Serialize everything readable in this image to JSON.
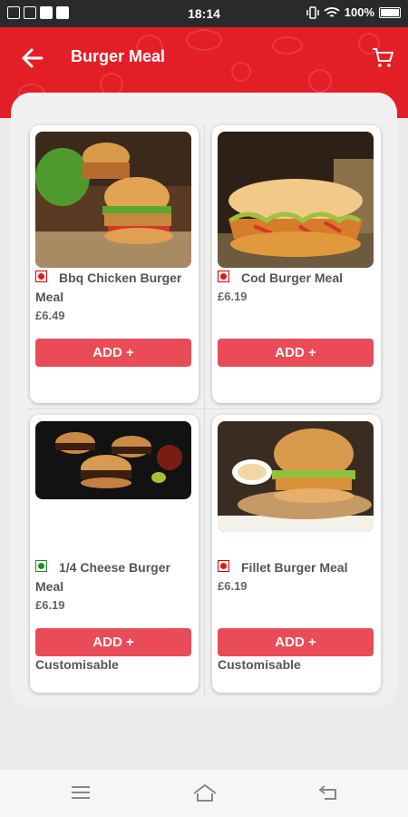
{
  "status_bar": {
    "time": "18:14",
    "battery": "100%"
  },
  "app_bar": {
    "title": "Burger Meal",
    "back_icon": "arrow-left-icon",
    "cart_icon": "cart-icon"
  },
  "products": [
    {
      "name": "Bbq Chicken Burger Meal",
      "price": "£6.49",
      "add_label": "ADD",
      "add_icon": "+",
      "diet": "non-veg",
      "customisable": ""
    },
    {
      "name": "Cod Burger Meal",
      "price": "£6.19",
      "add_label": "ADD",
      "add_icon": "+",
      "diet": "non-veg",
      "customisable": ""
    },
    {
      "name": "1/4 Cheese Burger Meal",
      "price": "£6.19",
      "add_label": "ADD",
      "add_icon": "+",
      "diet": "veg",
      "customisable": "Customisable"
    },
    {
      "name": "Fillet Burger Meal",
      "price": "£6.19",
      "add_label": "ADD",
      "add_icon": "+",
      "diet": "non-veg",
      "customisable": "Customisable"
    }
  ],
  "colors": {
    "brand_red": "#e41e26",
    "button_red": "#e94b57",
    "veg_green": "#1d8f1d"
  },
  "nav_bar": {
    "icons": [
      "menu-icon",
      "home-icon",
      "back-nav-icon"
    ]
  }
}
